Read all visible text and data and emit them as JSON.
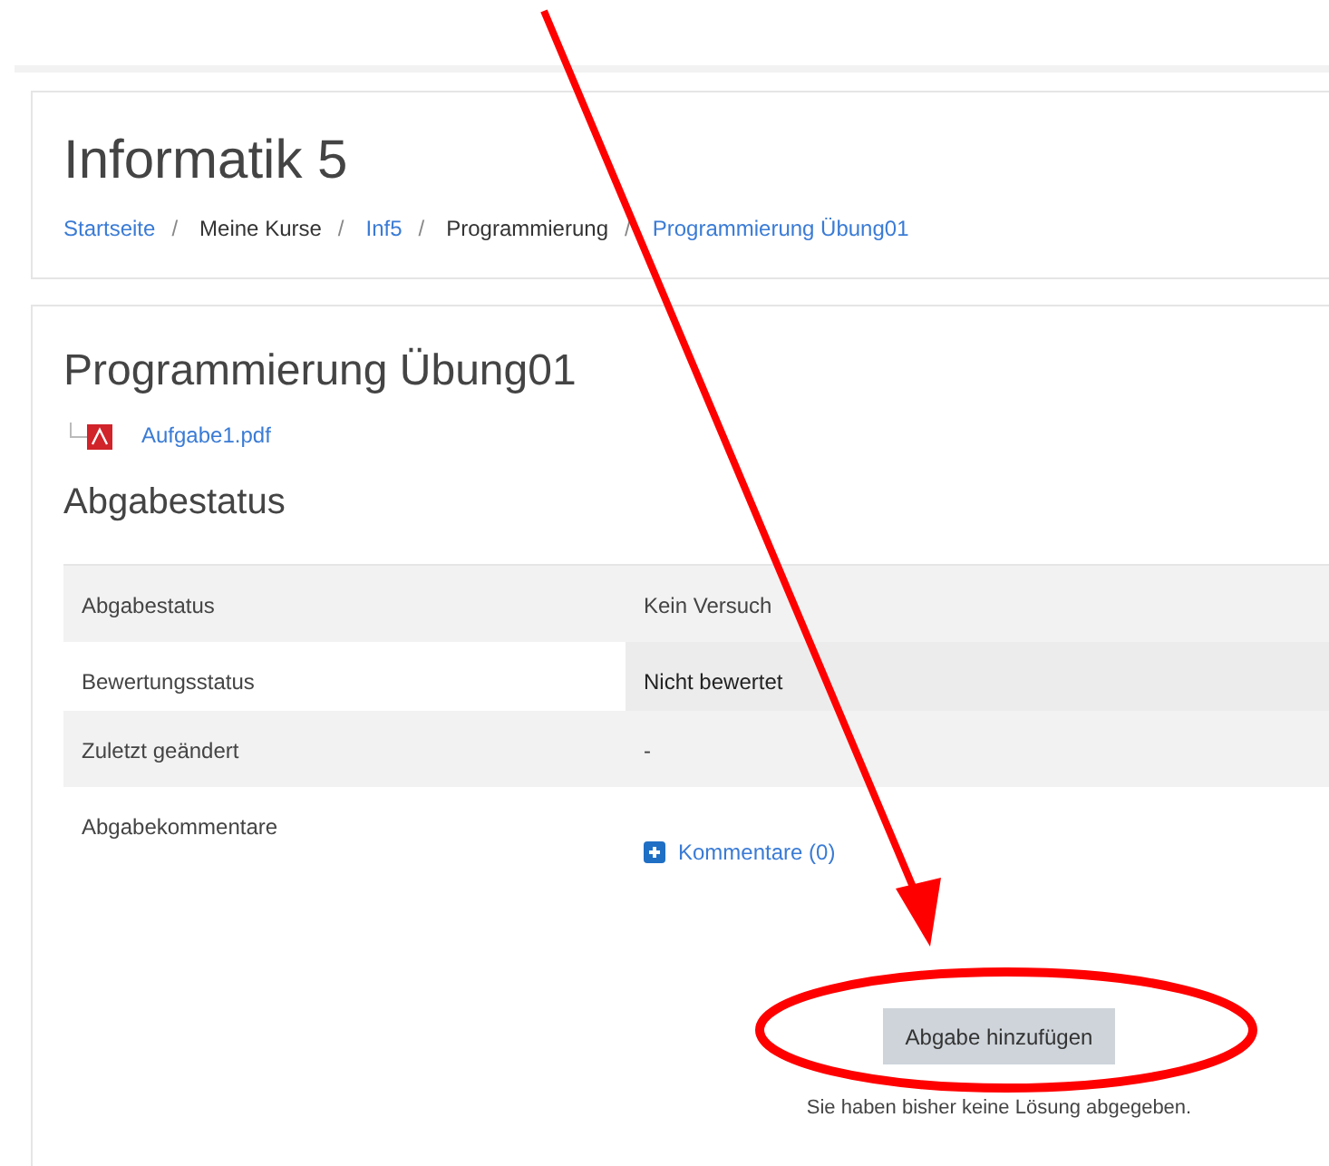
{
  "header": {
    "title": "Informatik 5",
    "breadcrumb": [
      {
        "label": "Startseite",
        "link": true
      },
      {
        "separator": "/",
        "label": "Meine Kurse",
        "link": false
      },
      {
        "separator": "/",
        "label": "Inf5",
        "link": true
      },
      {
        "separator": "/",
        "label": "Programmierung",
        "link": false
      },
      {
        "separator": "/",
        "label": "Programmierung Übung01",
        "link": true
      }
    ]
  },
  "assignment": {
    "title": "Programmierung Übung01",
    "attachment": "Aufgabe1.pdf",
    "status_heading": "Abgabestatus",
    "rows": [
      {
        "label": "Abgabestatus",
        "value": "Kein Versuch",
        "kind": "text",
        "shaded": true,
        "value_highlighted": false
      },
      {
        "label": "Bewertungsstatus",
        "value": "Nicht bewertet",
        "kind": "text",
        "shaded": false,
        "value_highlighted": true
      },
      {
        "label": "Zuletzt geändert",
        "value": "-",
        "kind": "text",
        "shaded": true,
        "value_highlighted": false
      },
      {
        "label": "Abgabekommentare",
        "value": "Kommentare (0)",
        "kind": "comments",
        "shaded": false,
        "value_highlighted": false
      }
    ],
    "button": "Abgabe hinzufügen",
    "note": "Sie haben bisher keine Lösung abgegeben."
  }
}
